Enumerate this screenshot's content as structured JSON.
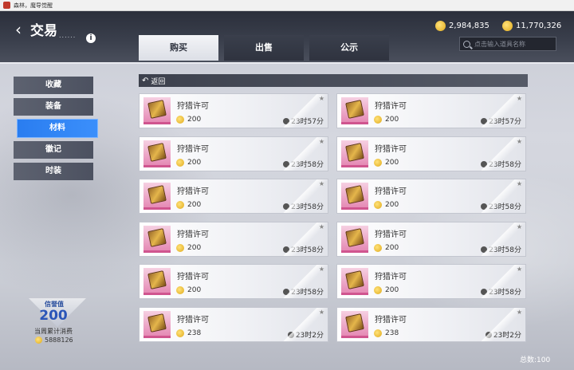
{
  "window": {
    "title": "森林，魔导觉醒"
  },
  "header": {
    "title": "交易",
    "title_dots": "......",
    "info_icon": "i",
    "back_icon": "‹",
    "gold": "2,984,835",
    "silver": "11,770,326"
  },
  "tabs": [
    {
      "label": "购买",
      "active": true
    },
    {
      "label": "出售",
      "active": false
    },
    {
      "label": "公示",
      "active": false
    }
  ],
  "search": {
    "placeholder": "点击输入道具名称"
  },
  "sidebar": [
    {
      "label": "收藏",
      "active": false
    },
    {
      "label": "装备",
      "active": false
    },
    {
      "label": "材料",
      "active": true
    },
    {
      "label": "徽记",
      "active": false
    },
    {
      "label": "时装",
      "active": false
    }
  ],
  "return": {
    "label": "返回"
  },
  "items": [
    {
      "name": "狩猎许可",
      "price": "200",
      "time": "23时57分"
    },
    {
      "name": "狩猎许可",
      "price": "200",
      "time": "23时57分"
    },
    {
      "name": "狩猎许可",
      "price": "200",
      "time": "23时58分"
    },
    {
      "name": "狩猎许可",
      "price": "200",
      "time": "23时58分"
    },
    {
      "name": "狩猎许可",
      "price": "200",
      "time": "23时58分"
    },
    {
      "name": "狩猎许可",
      "price": "200",
      "time": "23时58分"
    },
    {
      "name": "狩猎许可",
      "price": "200",
      "time": "23时58分"
    },
    {
      "name": "狩猎许可",
      "price": "200",
      "time": "23时58分"
    },
    {
      "name": "狩猎许可",
      "price": "200",
      "time": "23时58分"
    },
    {
      "name": "狩猎许可",
      "price": "200",
      "time": "23时58分"
    },
    {
      "name": "狩猎许可",
      "price": "238",
      "time": "23时2分"
    },
    {
      "name": "狩猎许可",
      "price": "238",
      "time": "23时2分"
    }
  ],
  "reputation": {
    "label": "信誉值",
    "value": "200",
    "weekly_label": "当周累计消费",
    "weekly_value": "5888126"
  },
  "footer": {
    "total": "总数:100"
  }
}
